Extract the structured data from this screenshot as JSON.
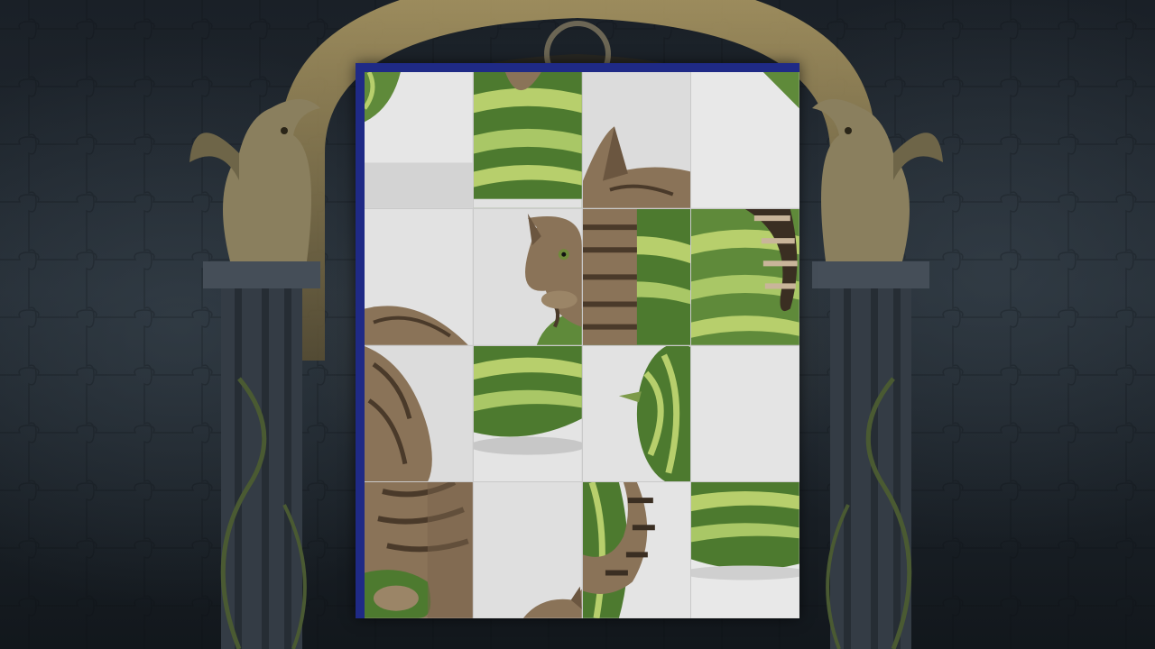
{
  "game": {
    "title": "",
    "image_subject": "tabby cat lying on a watermelon",
    "grid": {
      "rows": 4,
      "cols": 4
    },
    "frame_color": "#1f2a86",
    "tiles": [
      {
        "id": 1,
        "name": "melon-edge-top-left"
      },
      {
        "id": 2,
        "name": "cat-paw-on-melon-top"
      },
      {
        "id": 3,
        "name": "cat-ear-top"
      },
      {
        "id": 4,
        "name": "plain-background"
      },
      {
        "id": 5,
        "name": "plain-background-left"
      },
      {
        "id": 6,
        "name": "cat-face"
      },
      {
        "id": 7,
        "name": "cat-tail-on-melon"
      },
      {
        "id": 8,
        "name": "cat-back-fur"
      },
      {
        "id": 9,
        "name": "cat-body-side"
      },
      {
        "id": 10,
        "name": "melon-bottom"
      },
      {
        "id": 11,
        "name": "melon-stem"
      },
      {
        "id": 12,
        "name": "plain-background-right"
      },
      {
        "id": 13,
        "name": "cat-leg-on-melon"
      },
      {
        "id": 14,
        "name": "cat-ear-bottom"
      },
      {
        "id": 15,
        "name": "cat-tail-curl"
      },
      {
        "id": 16,
        "name": "melon-corner-bottom-right"
      }
    ]
  },
  "colors": {
    "background_dark": "#1c232b",
    "stone": "#3b434c",
    "gargoyle": "#8a7f5e",
    "melon_dark": "#3f6b2a",
    "melon_light": "#b7cf6c",
    "cat_fur": "#8a7358",
    "studio_bg": "#e4e4e4"
  }
}
